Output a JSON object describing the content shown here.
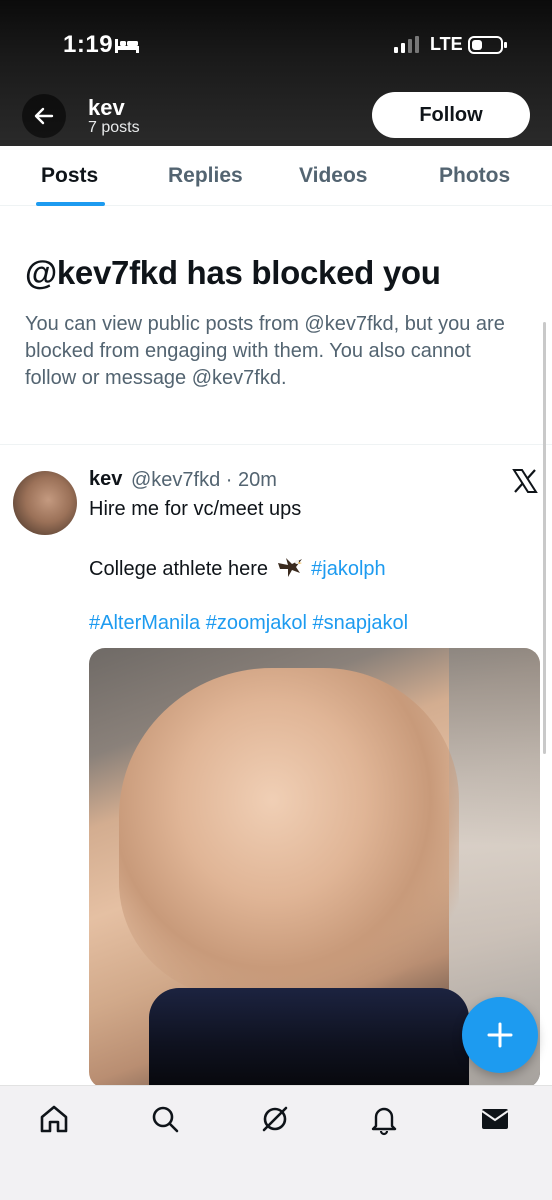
{
  "status_bar": {
    "time": "1:19",
    "sleep_icon": "bed-icon",
    "signal_icon": "signal-bars-icon",
    "network": "LTE",
    "battery_icon": "battery-icon"
  },
  "header": {
    "back_icon": "back-arrow-icon",
    "name": "kev",
    "post_count": "7 posts",
    "follow_label": "Follow"
  },
  "tabs": [
    {
      "label": "Posts",
      "active": true
    },
    {
      "label": "Replies",
      "active": false
    },
    {
      "label": "Videos",
      "active": false
    },
    {
      "label": "Photos",
      "active": false
    }
  ],
  "blocked": {
    "title": "@kev7fkd has blocked you",
    "message": "You can view public posts from @kev7fkd, but you are blocked from engaging with them. You also cannot follow or message @kev7fkd."
  },
  "post": {
    "author": "kev",
    "handle_time": "@kev7fkd · 20m",
    "line1": "Hire me for vc/meet ups",
    "line2_text": "College athlete here",
    "line2_hashtag": "#jakolph",
    "hashtags": [
      "#AlterManila",
      "#zoomjakol",
      "#snapjakol"
    ],
    "source_icon": "x-logo-icon"
  },
  "compose_icon": "plus-icon",
  "bottom_nav": [
    {
      "icon": "home-icon"
    },
    {
      "icon": "search-icon"
    },
    {
      "icon": "grok-icon"
    },
    {
      "icon": "notifications-bell-icon"
    },
    {
      "icon": "messages-envelope-icon"
    }
  ],
  "colors": {
    "accent": "#1d9bf0",
    "text_primary": "#0f1419",
    "text_secondary": "#536471"
  }
}
